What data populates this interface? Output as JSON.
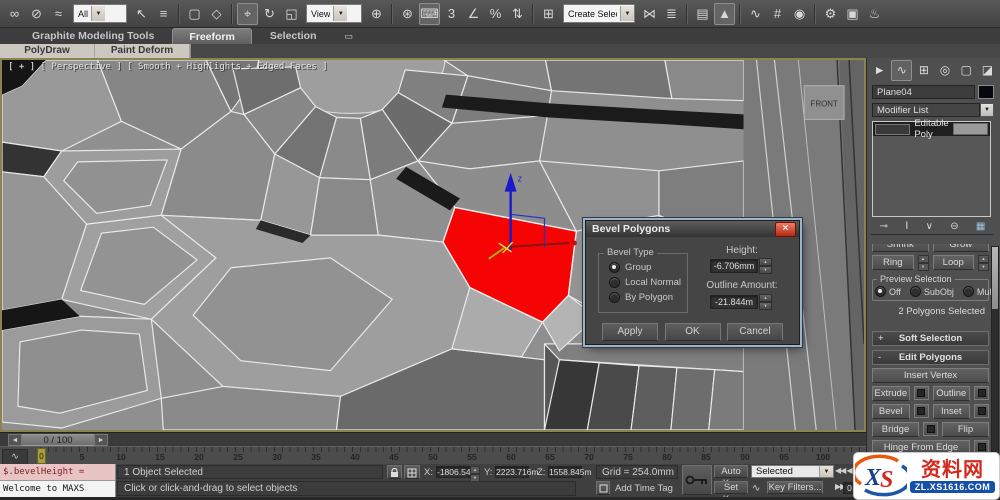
{
  "toolbar": {
    "all_dropdown": "All",
    "view_dropdown": "View",
    "selection_set_dropdown": "Create Selection Se",
    "icons": [
      {
        "name": "select-link-icon",
        "glyph": "∞"
      },
      {
        "name": "unlink-icon",
        "glyph": "⊘"
      },
      {
        "name": "bind-spacewarp-icon",
        "glyph": "≈"
      },
      {
        "name": "select-object-icon",
        "glyph": "↖"
      },
      {
        "name": "select-by-name-icon",
        "glyph": "≡"
      },
      {
        "name": "rect-region-icon",
        "glyph": "▢"
      },
      {
        "name": "window-crossing-icon",
        "glyph": "◇"
      },
      {
        "name": "move-icon",
        "glyph": "⌖"
      },
      {
        "name": "rotate-icon",
        "glyph": "↻"
      },
      {
        "name": "scale-icon",
        "glyph": "◱"
      },
      {
        "name": "pivot-center-icon",
        "glyph": "⊕"
      },
      {
        "name": "manipulate-icon",
        "glyph": "⊛"
      },
      {
        "name": "keyboard-override-icon",
        "glyph": "⌨"
      },
      {
        "name": "snap-3d-icon",
        "glyph": "3"
      },
      {
        "name": "angle-snap-icon",
        "glyph": "∠"
      },
      {
        "name": "percent-snap-icon",
        "glyph": "%"
      },
      {
        "name": "spinner-snap-icon",
        "glyph": "⇅"
      },
      {
        "name": "named-selection-icon",
        "glyph": "⊞"
      },
      {
        "name": "mirror-icon",
        "glyph": "⋈"
      },
      {
        "name": "align-icon",
        "glyph": "≣"
      },
      {
        "name": "layer-manager-icon",
        "glyph": "▤"
      },
      {
        "name": "ribbon-toggle-icon",
        "glyph": "▲"
      },
      {
        "name": "curve-editor-icon",
        "glyph": "∿"
      },
      {
        "name": "schematic-view-icon",
        "glyph": "#"
      },
      {
        "name": "material-editor-icon",
        "glyph": "◉"
      },
      {
        "name": "render-setup-icon",
        "glyph": "⚙"
      },
      {
        "name": "rendered-frame-icon",
        "glyph": "▣"
      },
      {
        "name": "render-icon",
        "glyph": "♨"
      }
    ]
  },
  "ribbon": {
    "tabs": [
      {
        "label": "Graphite Modeling Tools"
      },
      {
        "label": "Freeform"
      },
      {
        "label": "Selection"
      }
    ],
    "overflow_icon_glyph": "▭",
    "panel_buttons": [
      "PolyDraw",
      "Paint Deform"
    ]
  },
  "viewport": {
    "label": "[ + ]  [ Perspective ]  [ Smooth + Highlights + Edged Faces ]",
    "front_label": "FRONT",
    "axis_z_label": "z"
  },
  "dialog": {
    "title": "Bevel Polygons",
    "close_glyph": "×",
    "group_title": "Bevel Type",
    "radios": [
      {
        "label": "Group",
        "selected": true
      },
      {
        "label": "Local Normal",
        "selected": false
      },
      {
        "label": "By Polygon",
        "selected": false
      }
    ],
    "height_label": "Height:",
    "height_value": "-6.706mm",
    "outline_label": "Outline Amount:",
    "outline_value": "-21.844m",
    "apply_label": "Apply",
    "ok_label": "OK",
    "cancel_label": "Cancel"
  },
  "command_panel": {
    "tabs": [
      {
        "name": "create-tab-icon",
        "glyph": "►"
      },
      {
        "name": "modify-tab-icon",
        "glyph": "∿"
      },
      {
        "name": "hierarchy-tab-icon",
        "glyph": "⊞"
      },
      {
        "name": "motion-tab-icon",
        "glyph": "◎"
      },
      {
        "name": "display-tab-icon",
        "glyph": "▢"
      },
      {
        "name": "utilities-tab-icon",
        "glyph": "◪"
      }
    ],
    "object_name": "Plane04",
    "modifier_list_label": "Modifier List",
    "stack_item": "Editable Poly",
    "stack_icons": [
      {
        "name": "pin-stack-icon",
        "glyph": "⊸"
      },
      {
        "name": "show-end-result-icon",
        "glyph": "Ⅰ"
      },
      {
        "name": "make-unique-icon",
        "glyph": "∨"
      },
      {
        "name": "remove-modifier-icon",
        "glyph": "⊖"
      },
      {
        "name": "configure-sets-icon",
        "glyph": "▦"
      }
    ],
    "selection_buttons": {
      "shrink": "Shrink",
      "grow": "Grow",
      "ring": "Ring",
      "loop": "Loop"
    },
    "preview_selection": {
      "title": "Preview Selection",
      "options": [
        {
          "label": "Off",
          "selected": true
        },
        {
          "label": "SubObj",
          "selected": false
        },
        {
          "label": "Multi",
          "selected": false
        }
      ]
    },
    "polygons_selected": "2 Polygons Selected",
    "rollouts": [
      {
        "state": "+",
        "label": "Soft Selection"
      },
      {
        "state": "-",
        "label": "Edit Polygons"
      }
    ],
    "edit_polygons": {
      "insert_vertex": "Insert Vertex",
      "pairs": [
        [
          "Extrude",
          "Outline"
        ],
        [
          "Bevel",
          "Inset"
        ],
        [
          "Bridge",
          "Flip"
        ]
      ],
      "hinge": "Hinge From Edge"
    }
  },
  "timeline": {
    "slider_value": "0 / 100",
    "marker": "0",
    "ticks": [
      "5",
      "10",
      "15",
      "20",
      "25",
      "30",
      "35",
      "40",
      "45",
      "50",
      "55",
      "60",
      "65",
      "70",
      "75",
      "80",
      "85",
      "90",
      "95",
      "100"
    ]
  },
  "status_bar": {
    "listener_macro": "$.bevelHeight =",
    "listener_log": "Welcome to MAXS",
    "selection_status": "1 Object Selected",
    "prompt": "Click or click-and-drag to select objects",
    "x_label": "X:",
    "x_value": "-1806.543",
    "y_label": "Y:",
    "y_value": "2223.716m",
    "z_label": "Z:",
    "z_value": "1558.845m",
    "grid_label": "Grid = 254.0mm",
    "add_time_tag": "Add Time Tag",
    "auto_key": "Auto Key",
    "set_key": "Set Key",
    "key_mode_dropdown": "Selected",
    "key_filters": "Key Filters...",
    "frame_field": "0"
  },
  "watermark": {
    "logo_text": "XS",
    "site_name": "资料网",
    "site_url": "ZL.XS1616.COM"
  },
  "colors": {
    "selection_red": "#f60304",
    "gizmo_blue": "#1a1acc",
    "active_viewport_border": "#8a8550",
    "watermark_red": "#d42a1e",
    "watermark_blue": "#1550a8"
  }
}
